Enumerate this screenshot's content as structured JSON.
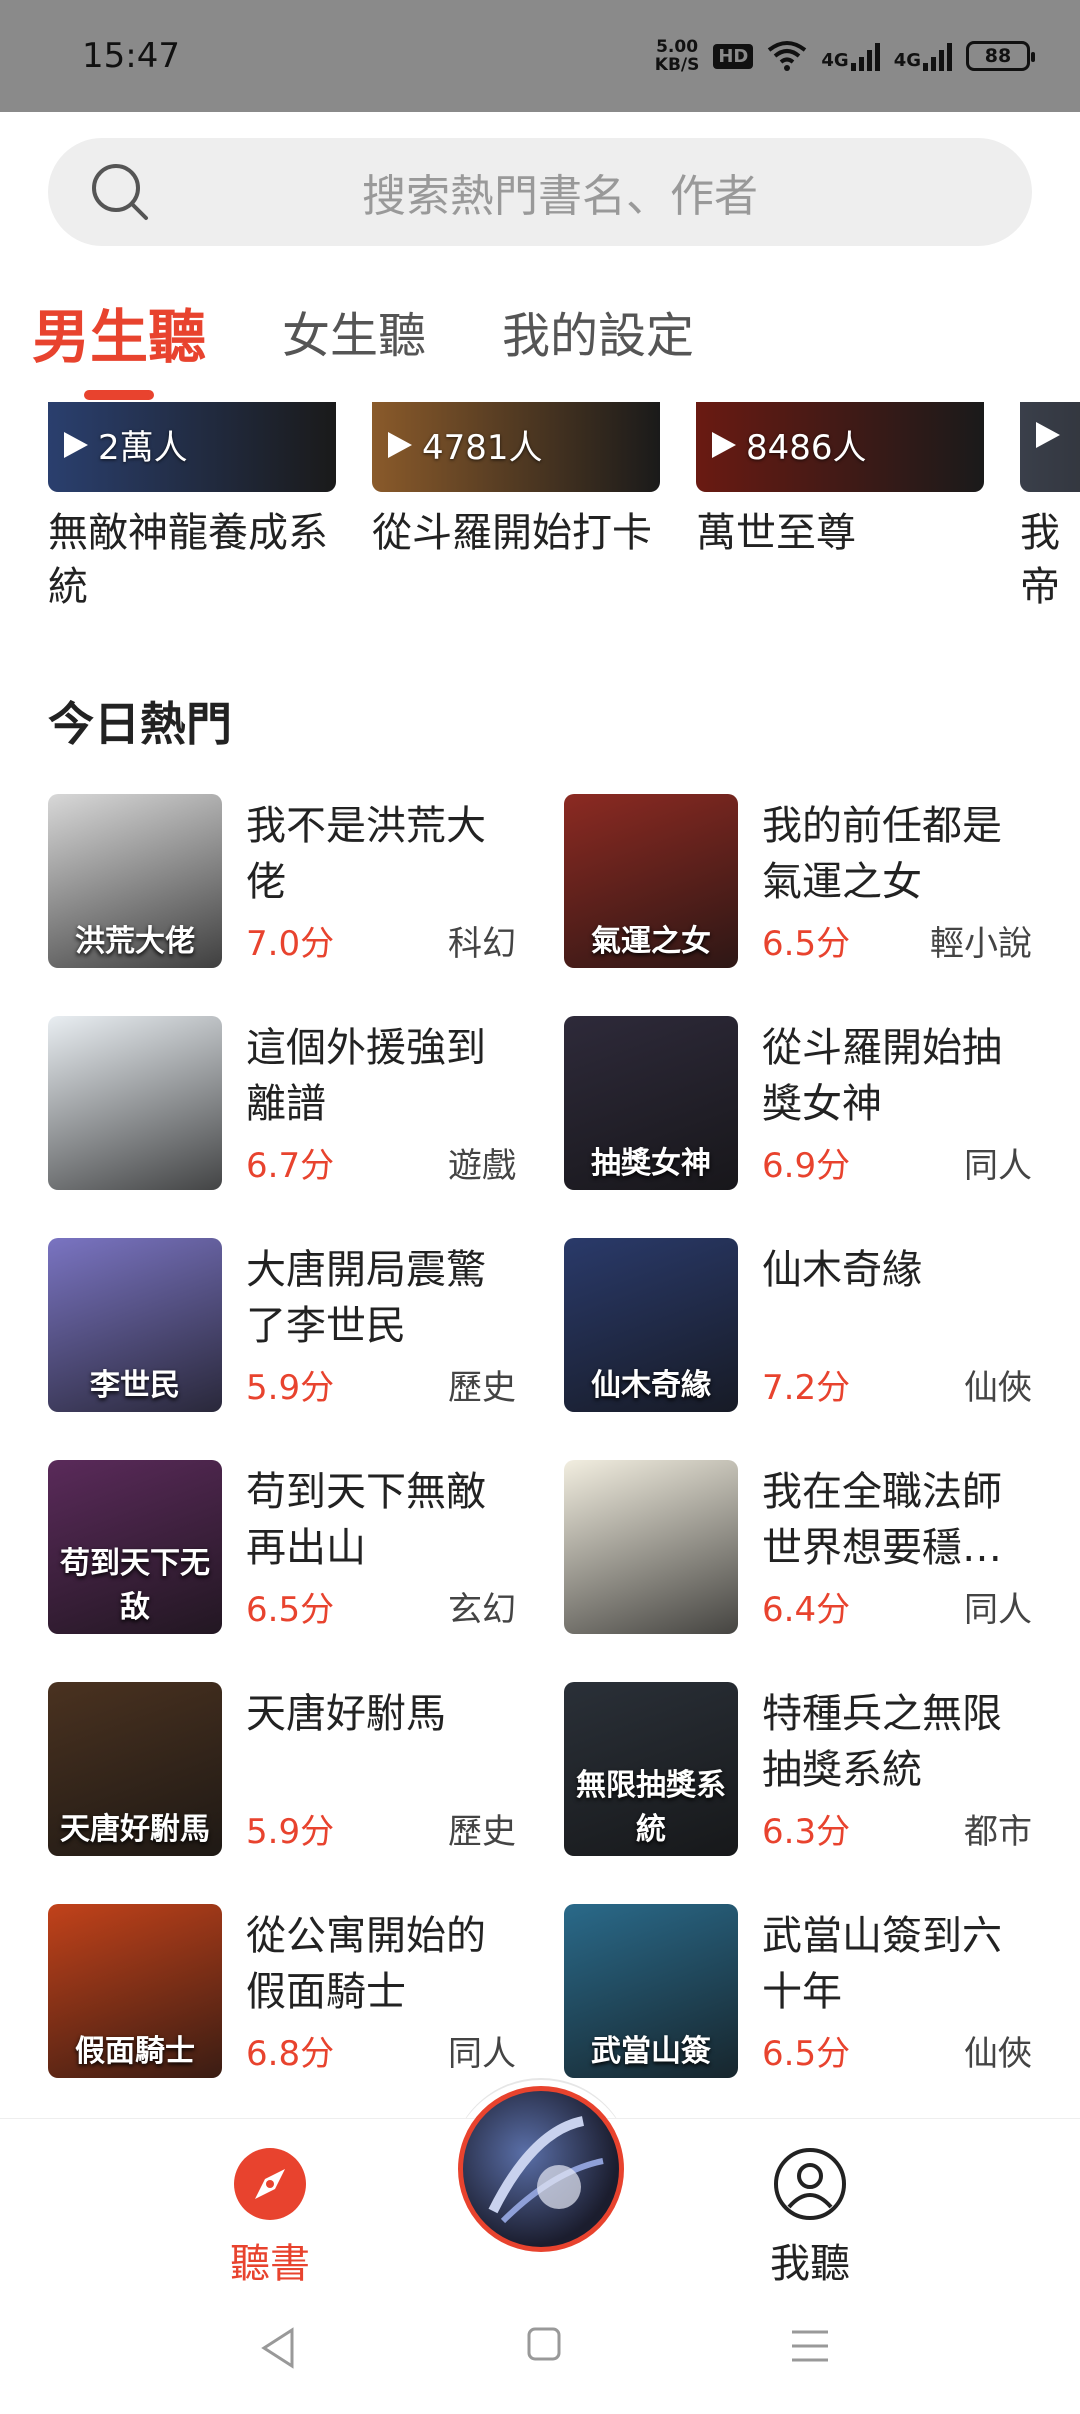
{
  "status_bar": {
    "time": "15:47",
    "speed": "5.00",
    "speed_unit": "KB/S",
    "hd": "HD",
    "net1": "4G",
    "net2": "4G",
    "battery": "88"
  },
  "search": {
    "placeholder": "搜索熱門書名、作者"
  },
  "tabs": [
    {
      "label": "男生聽",
      "active": true
    },
    {
      "label": "女生聽",
      "active": false
    },
    {
      "label": "我的設定",
      "active": false
    }
  ],
  "top_cards": [
    {
      "plays": "2萬人",
      "title": "無敵神龍養成系統",
      "color": "#2a3f6e"
    },
    {
      "plays": "4781人",
      "title": "從斗羅開始打卡",
      "color": "#8a5a2a"
    },
    {
      "plays": "8486人",
      "title": "萬世至尊",
      "color": "#6a1a12"
    },
    {
      "plays": "",
      "title": "我帝",
      "color": "#3a3f4a"
    }
  ],
  "section": {
    "title": "今日熱門"
  },
  "books": [
    {
      "title": "我不是洪荒大佬",
      "score": "7.0分",
      "genre": "科幻",
      "cover_text": "洪荒大佬",
      "color": "#d8d8d8"
    },
    {
      "title": "我的前任都是氣運之女",
      "score": "6.5分",
      "genre": "輕小說",
      "cover_text": "氣運之女",
      "color": "#8c2a22"
    },
    {
      "title": "這個外援強到離譜",
      "score": "6.7分",
      "genre": "遊戲",
      "cover_text": "",
      "color": "#e9eef2"
    },
    {
      "title": "從斗羅開始抽獎女神",
      "score": "6.9分",
      "genre": "同人",
      "cover_text": "抽獎女神",
      "color": "#2e2a3a"
    },
    {
      "title": "大唐開局震驚了李世民",
      "score": "5.9分",
      "genre": "歷史",
      "cover_text": "李世民",
      "color": "#7a74c2"
    },
    {
      "title": "仙木奇緣",
      "score": "7.2分",
      "genre": "仙俠",
      "cover_text": "仙木奇緣",
      "color": "#2a3a6a"
    },
    {
      "title": "苟到天下無敵再出山",
      "score": "6.5分",
      "genre": "玄幻",
      "cover_text": "苟到天下无敌",
      "color": "#5a2a5a"
    },
    {
      "title": "我在全職法師世界想要穩…",
      "score": "6.4分",
      "genre": "同人",
      "cover_text": "",
      "color": "#f2eee0"
    },
    {
      "title": "天唐好駙馬",
      "score": "5.9分",
      "genre": "歷史",
      "cover_text": "天唐好駙馬",
      "color": "#4a3220"
    },
    {
      "title": "特種兵之無限抽獎系統",
      "score": "6.3分",
      "genre": "都市",
      "cover_text": "無限抽獎系統",
      "color": "#2a3038"
    },
    {
      "title": "從公寓開始的假面騎士",
      "score": "6.8分",
      "genre": "同人",
      "cover_text": "假面騎士",
      "color": "#c2421a"
    },
    {
      "title": "武當山簽到六十年",
      "score": "6.5分",
      "genre": "仙俠",
      "cover_text": "武當山簽",
      "color": "#2a6a8a"
    }
  ],
  "bottom_nav": {
    "books_label": "聽書",
    "mine_label": "我聽"
  },
  "colors": {
    "accent": "#e8432e"
  }
}
